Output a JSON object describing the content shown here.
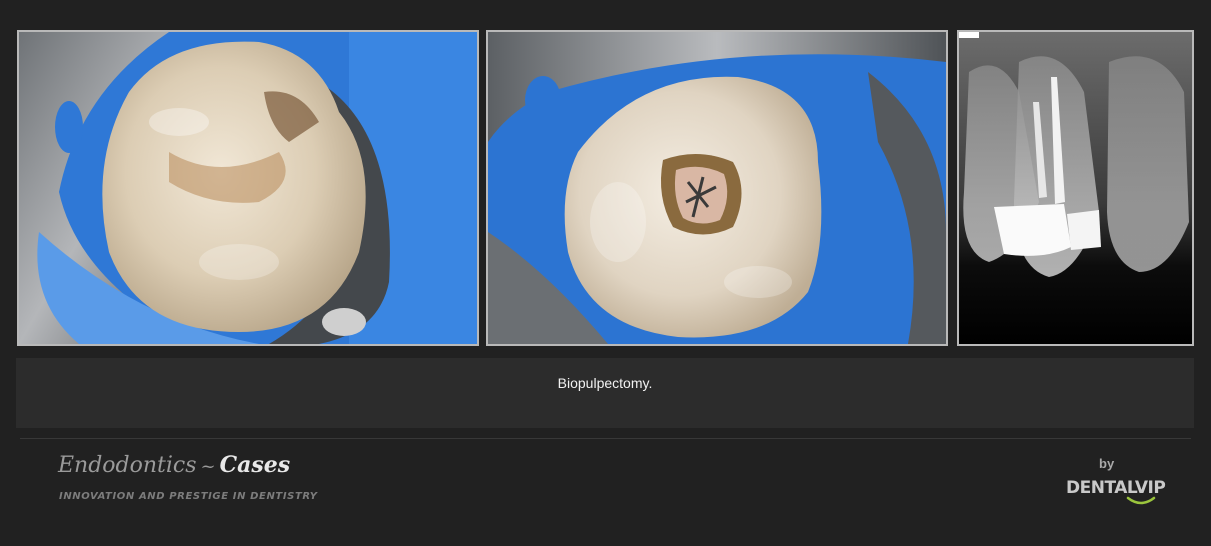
{
  "gallery": {
    "images": [
      {
        "name": "intraoral photo pre-op"
      },
      {
        "name": "intraoral photo access cavity"
      },
      {
        "name": "periapical radiograph"
      }
    ],
    "caption": "Biopulpectomy."
  },
  "footer": {
    "brand_part1": "Endodontics",
    "brand_separator": "~",
    "brand_part2": "Cases",
    "tagline": "INNOVATION AND PRESTIGE IN DENTISTRY",
    "by_label": "by",
    "vendor_logo_text": "DENTALVIP"
  },
  "colors": {
    "background": "#212121",
    "caption_bar": "#2c2c2c",
    "logo_swoosh": "#9bc53d"
  }
}
